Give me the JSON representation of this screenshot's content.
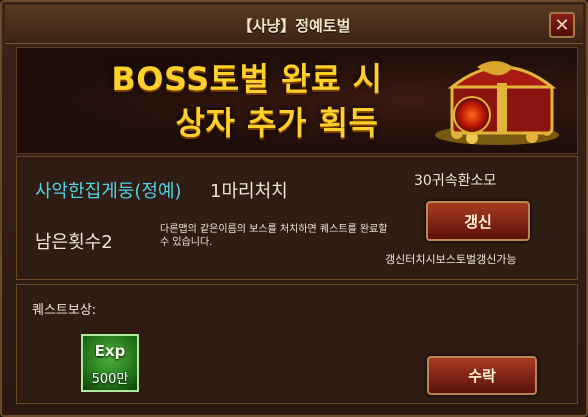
{
  "window": {
    "title": "【사냥】정예토벌"
  },
  "banner": {
    "line1": "BOSS토벌 완료 시",
    "line2": "상자 추가 획득"
  },
  "quest": {
    "target_name": "사악한집게둥(정예)",
    "target_count": "1마리처치",
    "remaining": "남은횟수2",
    "description": "다른맵의 같은이름의 보스를 처치하면 퀘스트를 완료할 수 있습니다.",
    "renew_cost": "30귀속환소모",
    "renew_label": "갱신",
    "renew_note": "갱신터치시보스토벌갱신가능"
  },
  "reward": {
    "label": "퀘스트보상:",
    "item_name": "Exp",
    "item_amount": "500만",
    "accept_label": "수락"
  },
  "colors": {
    "banner_text": "#ffd02a",
    "target_name": "#4fd3e8",
    "button": "#a83a24"
  }
}
